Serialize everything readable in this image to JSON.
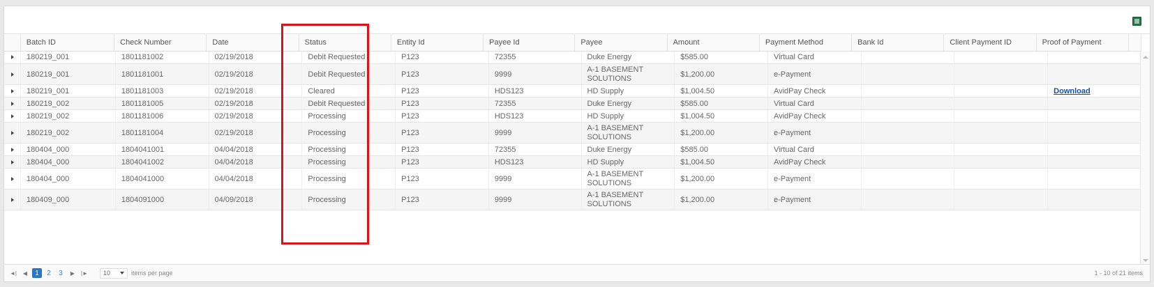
{
  "columns": [
    "Batch ID",
    "Check Number",
    "Date",
    "Status",
    "Entity Id",
    "Payee Id",
    "Payee",
    "Amount",
    "Payment Method",
    "Bank Id",
    "Client Payment ID",
    "Proof of Payment"
  ],
  "rows": [
    {
      "batch_id": "180219_001",
      "check_number": "1801181002",
      "date": "02/19/2018",
      "status": "Debit Requested",
      "entity_id": "P123",
      "payee_id": "72355",
      "payee": "Duke Energy",
      "amount": "$585.00",
      "payment_method": "Virtual Card",
      "bank_id": "",
      "client_payment_id": "",
      "proof": ""
    },
    {
      "batch_id": "180219_001",
      "check_number": "1801181001",
      "date": "02/19/2018",
      "status": "Debit Requested",
      "entity_id": "P123",
      "payee_id": "9999",
      "payee": "A-1 BASEMENT SOLUTIONS",
      "amount": "$1,200.00",
      "payment_method": "e-Payment",
      "bank_id": "",
      "client_payment_id": "",
      "proof": ""
    },
    {
      "batch_id": "180219_001",
      "check_number": "1801181003",
      "date": "02/19/2018",
      "status": "Cleared",
      "entity_id": "P123",
      "payee_id": "HDS123",
      "payee": "HD Supply",
      "amount": "$1,004.50",
      "payment_method": "AvidPay Check",
      "bank_id": "",
      "client_payment_id": "",
      "proof": "Download"
    },
    {
      "batch_id": "180219_002",
      "check_number": "1801181005",
      "date": "02/19/2018",
      "status": "Debit Requested",
      "entity_id": "P123",
      "payee_id": "72355",
      "payee": "Duke Energy",
      "amount": "$585.00",
      "payment_method": "Virtual Card",
      "bank_id": "",
      "client_payment_id": "",
      "proof": ""
    },
    {
      "batch_id": "180219_002",
      "check_number": "1801181006",
      "date": "02/19/2018",
      "status": "Processing",
      "entity_id": "P123",
      "payee_id": "HDS123",
      "payee": "HD Supply",
      "amount": "$1,004.50",
      "payment_method": "AvidPay Check",
      "bank_id": "",
      "client_payment_id": "",
      "proof": ""
    },
    {
      "batch_id": "180219_002",
      "check_number": "1801181004",
      "date": "02/19/2018",
      "status": "Processing",
      "entity_id": "P123",
      "payee_id": "9999",
      "payee": "A-1 BASEMENT SOLUTIONS",
      "amount": "$1,200.00",
      "payment_method": "e-Payment",
      "bank_id": "",
      "client_payment_id": "",
      "proof": ""
    },
    {
      "batch_id": "180404_000",
      "check_number": "1804041001",
      "date": "04/04/2018",
      "status": "Processing",
      "entity_id": "P123",
      "payee_id": "72355",
      "payee": "Duke Energy",
      "amount": "$585.00",
      "payment_method": "Virtual Card",
      "bank_id": "",
      "client_payment_id": "",
      "proof": ""
    },
    {
      "batch_id": "180404_000",
      "check_number": "1804041002",
      "date": "04/04/2018",
      "status": "Processing",
      "entity_id": "P123",
      "payee_id": "HDS123",
      "payee": "HD Supply",
      "amount": "$1,004.50",
      "payment_method": "AvidPay Check",
      "bank_id": "",
      "client_payment_id": "",
      "proof": ""
    },
    {
      "batch_id": "180404_000",
      "check_number": "1804041000",
      "date": "04/04/2018",
      "status": "Processing",
      "entity_id": "P123",
      "payee_id": "9999",
      "payee": "A-1 BASEMENT SOLUTIONS",
      "amount": "$1,200.00",
      "payment_method": "e-Payment",
      "bank_id": "",
      "client_payment_id": "",
      "proof": ""
    },
    {
      "batch_id": "180409_000",
      "check_number": "1804091000",
      "date": "04/09/2018",
      "status": "Processing",
      "entity_id": "P123",
      "payee_id": "9999",
      "payee": "A-1 BASEMENT SOLUTIONS",
      "amount": "$1,200.00",
      "payment_method": "e-Payment",
      "bank_id": "",
      "client_payment_id": "",
      "proof": ""
    }
  ],
  "pager": {
    "first_icon": "first-page-icon",
    "prev_icon": "prev-page-icon",
    "next_icon": "next-page-icon",
    "last_icon": "last-page-icon",
    "pages": [
      "1",
      "2",
      "3"
    ],
    "current_page": "1",
    "per_page": "10",
    "items_per_page_label": "items per page",
    "range_text": "1 - 10 of 21 items"
  },
  "toolbar": {
    "export_icon": "excel-export-icon"
  },
  "colors": {
    "accent": "#2a76c4",
    "highlight_border": "#d7141a",
    "link": "#1a4fa0"
  }
}
